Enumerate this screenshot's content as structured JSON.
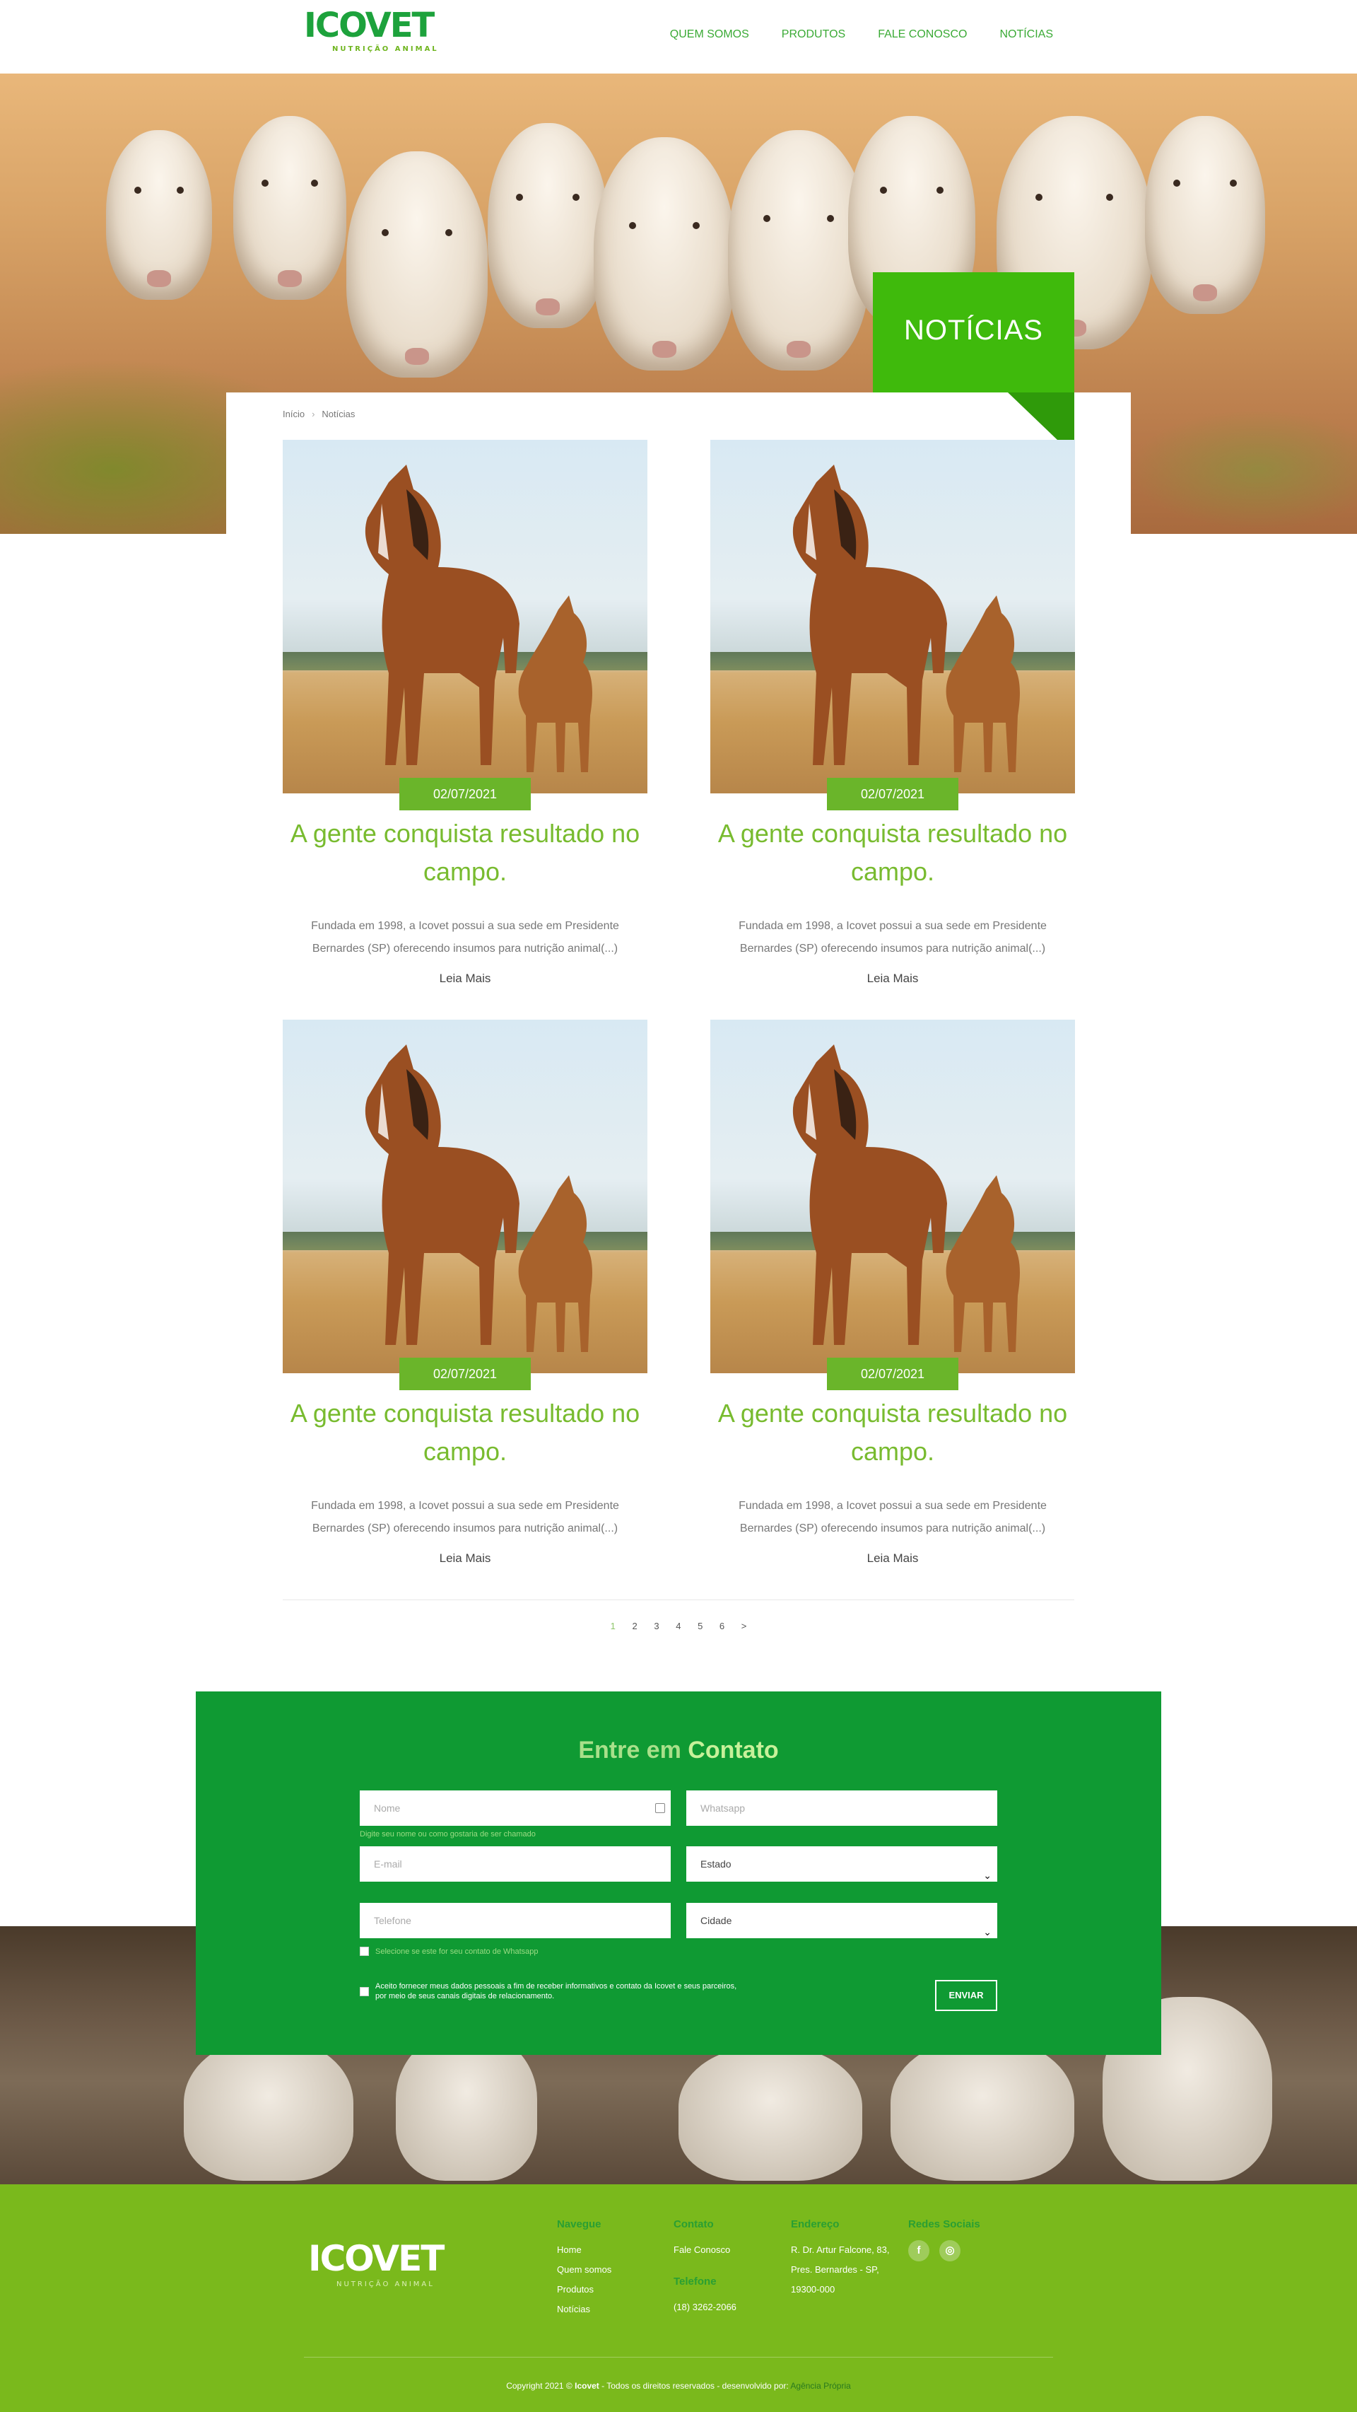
{
  "brand": {
    "name": "ICOVET",
    "tagline": "NUTRIÇÃO ANIMAL"
  },
  "nav": {
    "items": [
      "QUEM SOMOS",
      "PRODUTOS",
      "FALE CONOSCO",
      "NOTÍCIAS"
    ]
  },
  "hero": {
    "badge": "NOTÍCIAS"
  },
  "breadcrumb": {
    "home": "Início",
    "separator": "›",
    "current": "Notícias"
  },
  "posts": [
    {
      "date": "02/07/2021",
      "title": "A gente conquista resultado no campo.",
      "excerpt": "Fundada em 1998, a Icovet possui a sua sede em Presidente Bernardes (SP) oferecendo insumos para nutrição animal(...)",
      "more": "Leia Mais"
    },
    {
      "date": "02/07/2021",
      "title": "A gente conquista resultado no campo.",
      "excerpt": "Fundada em 1998, a Icovet possui a sua sede em Presidente Bernardes (SP) oferecendo insumos para nutrição animal(...)",
      "more": "Leia Mais"
    },
    {
      "date": "02/07/2021",
      "title": "A gente conquista resultado no campo.",
      "excerpt": "Fundada em 1998, a Icovet possui a sua sede em Presidente Bernardes (SP) oferecendo insumos para nutrição animal(...)",
      "more": "Leia Mais"
    },
    {
      "date": "02/07/2021",
      "title": "A gente conquista resultado no campo.",
      "excerpt": "Fundada em 1998, a Icovet possui a sua sede em Presidente Bernardes (SP) oferecendo insumos para nutrição animal(...)",
      "more": "Leia Mais"
    }
  ],
  "pagination": {
    "pages": [
      "1",
      "2",
      "3",
      "4",
      "5",
      "6",
      ">"
    ],
    "current": "1"
  },
  "contact": {
    "title_light": "Entre em",
    "title_bold": "Contato",
    "name_placeholder": "Nome",
    "name_hint": "Digite seu nome ou como gostaria de ser chamado",
    "whatsapp_placeholder": "Whatsapp",
    "email_placeholder": "E-mail",
    "state_label": "Estado",
    "phone_placeholder": "Telefone",
    "city_label": "Cidade",
    "whatsapp_check": "Selecione se este for seu contato de Whatsapp",
    "consent": "Aceito fornecer meus dados pessoais a fim de receber informativos e contato da Icovet e seus parceiros, por meio de seus canais digitais de relacionamento.",
    "send": "ENVIAR"
  },
  "footer": {
    "navigate": {
      "title": "Navegue",
      "links": [
        "Home",
        "Quem somos",
        "Produtos",
        "Notícias"
      ]
    },
    "contact": {
      "title": "Contato",
      "link": "Fale Conosco",
      "phone_title": "Telefone",
      "phone": "(18) 3262-2066"
    },
    "address": {
      "title": "Endereço",
      "lines": [
        "R. Dr. Artur Falcone, 83,",
        "Pres. Bernardes - SP,",
        "19300-000"
      ]
    },
    "social": {
      "title": "Redes Sociais",
      "icons": [
        "facebook-icon",
        "instagram-icon"
      ]
    },
    "copyright_pre": "Copyright 2021 ©",
    "copyright_brand": "Icovet",
    "copyright_post": "- Todos os direitos reservados - desenvolvido por:",
    "developer": "Agência Própria"
  },
  "colors": {
    "primary_green": "#1da23c",
    "light_green": "#78bb2f",
    "footer_green": "#7ab91c",
    "contact_green": "#0f9a33",
    "badge_green": "#3fba0c"
  }
}
